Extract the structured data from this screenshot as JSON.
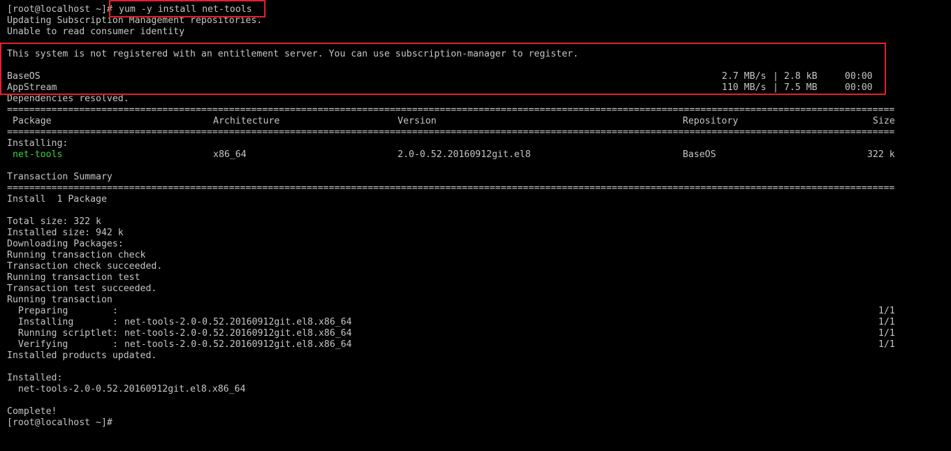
{
  "colors": {
    "background": "#000000",
    "text": "#c6c6c6",
    "package": "#3fd23f",
    "highlight": "#e8202a"
  },
  "prompt": "[root@localhost ~]#",
  "command": "yum -y install net-tools",
  "repo_messages": [
    "Updating Subscription Management repositories.",
    "Unable to read consumer identity"
  ],
  "registration_notice": "This system is not registered with an entitlement server. You can use subscription-manager to register.",
  "repos": [
    {
      "name": "BaseOS",
      "speed": "2.7 MB/s",
      "size": "2.8 kB",
      "time": "00:00"
    },
    {
      "name": "AppStream",
      "speed": "110 MB/s",
      "size": "7.5 MB",
      "time": "00:00"
    }
  ],
  "dependencies_resolved": "Dependencies resolved.",
  "table_headers": {
    "package": "Package",
    "architecture": "Architecture",
    "version": "Version",
    "repository": "Repository",
    "size": "Size"
  },
  "installing_label": "Installing:",
  "package_row": {
    "package": "net-tools",
    "architecture": "x86_64",
    "version": "2.0-0.52.20160912git.el8",
    "repository": "BaseOS",
    "size": "322 k"
  },
  "transaction_summary": "Transaction Summary",
  "install_count": "Install  1 Package",
  "log_lines": [
    "Total size: 322 k",
    "Installed size: 942 k",
    "Downloading Packages:",
    "Running transaction check",
    "Transaction check succeeded.",
    "Running transaction test",
    "Transaction test succeeded.",
    "Running transaction"
  ],
  "steps": [
    {
      "label": "  Preparing        :",
      "detail": "",
      "progress": "1/1"
    },
    {
      "label": "  Installing       :",
      "detail": " net-tools-2.0-0.52.20160912git.el8.x86_64",
      "progress": "1/1"
    },
    {
      "label": "  Running scriptlet:",
      "detail": " net-tools-2.0-0.52.20160912git.el8.x86_64",
      "progress": "1/1"
    },
    {
      "label": "  Verifying        :",
      "detail": " net-tools-2.0-0.52.20160912git.el8.x86_64",
      "progress": "1/1"
    }
  ],
  "products_updated": "Installed products updated.",
  "installed_label": "Installed:",
  "installed_package": "  net-tools-2.0-0.52.20160912git.el8.x86_64",
  "complete": "Complete!",
  "final_prompt": "[root@localhost ~]#"
}
